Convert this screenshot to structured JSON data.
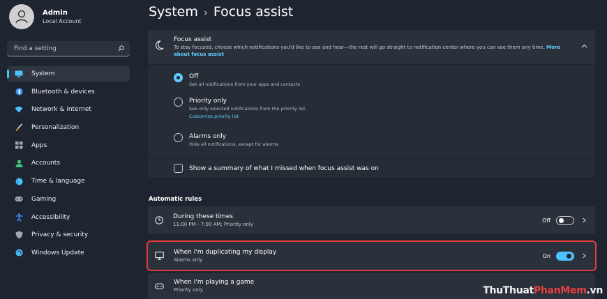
{
  "user": {
    "name": "Admin",
    "account": "Local Account"
  },
  "search": {
    "placeholder": "Find a setting"
  },
  "sidebar": {
    "items": [
      {
        "label": "System",
        "icon": "monitor-icon",
        "color": "#4cc2ff",
        "active": true
      },
      {
        "label": "Bluetooth & devices",
        "icon": "bluetooth-icon",
        "color": "#3b8ef5"
      },
      {
        "label": "Network & internet",
        "icon": "wifi-icon",
        "color": "#4cc2ff"
      },
      {
        "label": "Personalization",
        "icon": "brush-icon",
        "color": "#e8a23c"
      },
      {
        "label": "Apps",
        "icon": "apps-icon",
        "color": "#a0a8b4"
      },
      {
        "label": "Accounts",
        "icon": "person-icon",
        "color": "#3fc77a"
      },
      {
        "label": "Time & language",
        "icon": "globe-icon",
        "color": "#4cc2ff"
      },
      {
        "label": "Gaming",
        "icon": "gamepad-icon",
        "color": "#a0a8b4"
      },
      {
        "label": "Accessibility",
        "icon": "accessibility-icon",
        "color": "#3b8ef5"
      },
      {
        "label": "Privacy & security",
        "icon": "shield-icon",
        "color": "#a0a8b4"
      },
      {
        "label": "Windows Update",
        "icon": "update-icon",
        "color": "#4cc2ff"
      }
    ]
  },
  "header": {
    "section": "System",
    "separator": "›",
    "page": "Focus assist"
  },
  "focus_assist": {
    "title": "Focus assist",
    "description": "To stay focused, choose which notifications you'd like to see and hear—the rest will go straight to notification center where you can see them any time.",
    "link": "More about focus assist",
    "options": [
      {
        "title": "Off",
        "desc": "Get all notifications from your apps and contacts",
        "selected": true
      },
      {
        "title": "Priority only",
        "desc": "See only selected notifications from the priority list",
        "link": "Customize priority list"
      },
      {
        "title": "Alarms only",
        "desc": "Hide all notifications, except for alarms"
      }
    ],
    "summary_label": "Show a summary of what I missed when focus assist was on"
  },
  "automatic_rules": {
    "title": "Automatic rules",
    "rules": [
      {
        "title": "During these times",
        "desc": "11:00 PM - 7:00 AM; Priority only",
        "state": "Off",
        "on": false,
        "icon": "clock-icon"
      },
      {
        "title": "When I'm duplicating my display",
        "desc": "Alarms only",
        "state": "On",
        "on": true,
        "icon": "display-icon"
      },
      {
        "title": "When I'm playing a game",
        "desc": "Priority only",
        "icon": "gamepad-icon"
      }
    ]
  },
  "watermark": {
    "part1": "ThuThuat",
    "part2": "PhanMem",
    "part3": ".vn"
  },
  "colors": {
    "accent": "#4cc2ff",
    "highlight": "#e23b3b",
    "background": "#1f2530"
  }
}
